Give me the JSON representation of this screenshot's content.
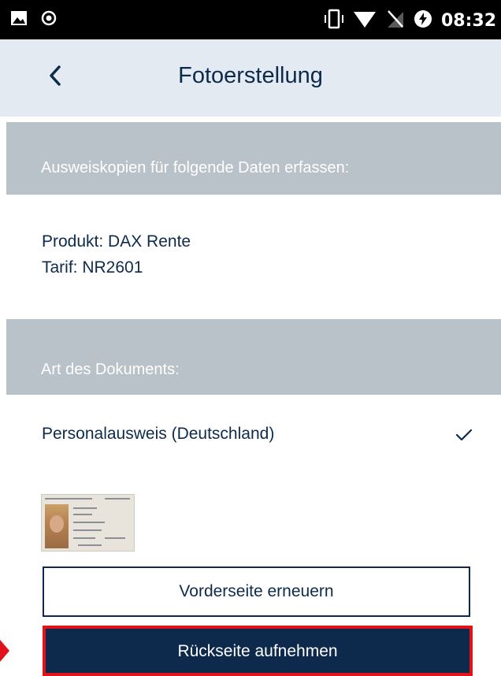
{
  "status_bar": {
    "time": "08:32",
    "left_icons": [
      "image-icon",
      "location-target-icon"
    ],
    "right_icons": [
      "vibrate-icon",
      "wifi-icon",
      "no-sim-icon",
      "data-saver-icon"
    ]
  },
  "header": {
    "title": "Fotoerstellung",
    "back_icon": "chevron-left-icon"
  },
  "sections": {
    "capture_header": "Ausweiskopien für folgende Daten erfassen:",
    "product": "Produkt: DAX Rente",
    "tariff": "Tarif: NR2601",
    "document_header": "Art des Dokuments:",
    "document_type": "Personalausweis (Deutschland)"
  },
  "actions": {
    "renew_front": "Vorderseite erneuern",
    "capture_back": "Rückseite aufnehmen"
  },
  "colors": {
    "navy": "#0d2a4c",
    "header_bg": "#e3eaf1",
    "section_bg": "#b9c1c9",
    "highlight": "#e0131b"
  }
}
